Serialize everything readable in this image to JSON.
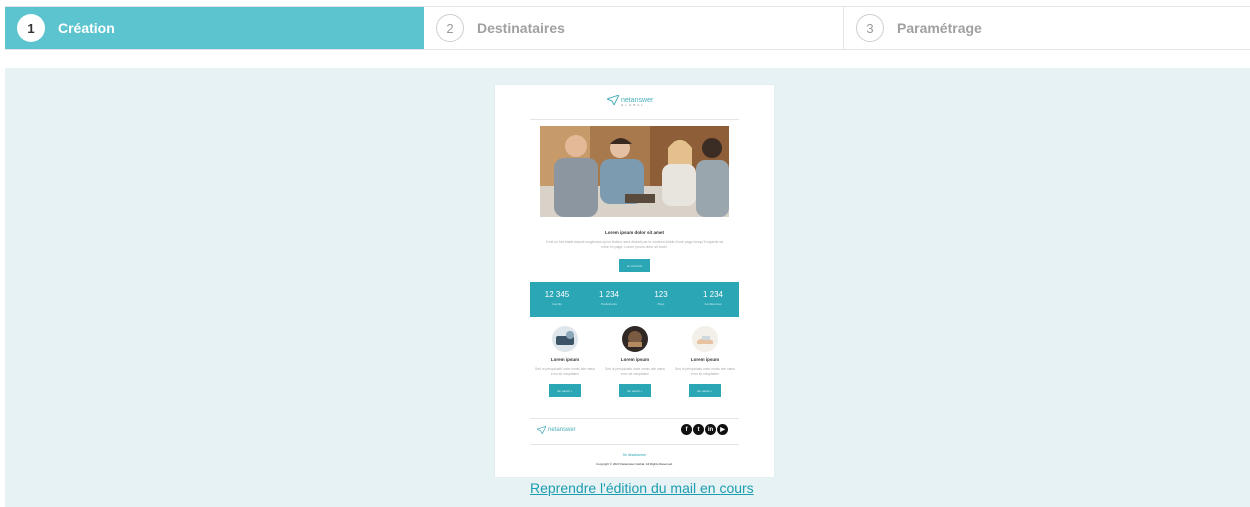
{
  "steps": [
    {
      "number": "1",
      "label": "Création",
      "active": true
    },
    {
      "number": "2",
      "label": "Destinataires",
      "active": false
    },
    {
      "number": "3",
      "label": "Paramétrage",
      "active": false
    }
  ],
  "mail": {
    "brand_name": "netanswer",
    "brand_sub": "GLOBAL",
    "title": "Lorem ipsum dolor sit amet",
    "paragraph": "Il est un fait établi depuis longtemps qu'un lecteur sera distrait par le contenu lisible d'une page lorsqu'il regarde sa mise en page. Lorem ipsum dolor sit amet.",
    "main_button": "Je m'inscris",
    "stats": [
      {
        "value": "12 345",
        "label": "Inscrits"
      },
      {
        "value": "1 234",
        "label": "Participants"
      },
      {
        "value": "123",
        "label": "Pays"
      },
      {
        "value": "1 234",
        "label": "Conférences"
      }
    ],
    "columns": [
      {
        "title": "Lorem ipsum",
        "text": "Sed ut perspiciatis unde omnis iste natus error sit voluptatem",
        "button": "En savoir +"
      },
      {
        "title": "Lorem ipsum",
        "text": "Sed ut perspiciatis unde omnis iste natus error sit voluptatem",
        "button": "En savoir +"
      },
      {
        "title": "Lorem ipsum",
        "text": "Sed ut perspiciatis unde omnis iste natus error sit voluptatem",
        "button": "En savoir +"
      }
    ],
    "social": [
      "f",
      "t",
      "in",
      "▶"
    ],
    "unsubscribe": "Se désabonner",
    "copyright": "Copyright © 2023 Netanswer Global. All Rights Reserved."
  },
  "resume_link": "Reprendre l'édition du mail en cours",
  "colors": {
    "accent": "#5cc4cf",
    "teal_dark": "#2aa6b4",
    "preview_bg": "#e6f2f4"
  }
}
